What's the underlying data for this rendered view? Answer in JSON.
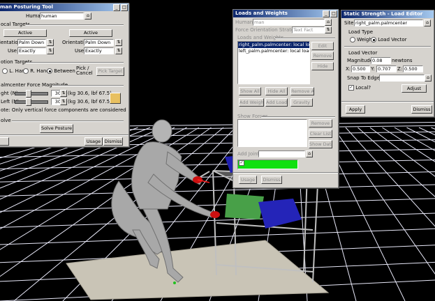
{
  "posture_tool": {
    "title": "man Posturing Tool",
    "human_label": "Human:",
    "human_value": "human",
    "local_targets": "ocal Targets",
    "active_left": "Active",
    "active_right": "Active",
    "orientation_label_left": "ientation:",
    "orientation_left": "Palm Down",
    "orientation_label_right": "Orientation:",
    "orientation_right": "Palm Down",
    "use_label": "Use:",
    "use_left": "Exactly",
    "use_right": "Exactly",
    "motion_targets": "otion Targets",
    "l_hand": "L. Hand",
    "r_hand": "R. Hand",
    "between": "Between",
    "pick_cancel": "Pick / Cancel",
    "pick_target": "Pick Target",
    "force_title": "almcenter Force Magnitude",
    "right_label": "ght (N):",
    "right_value": "30",
    "right_info": "(kg 30.6, lbf 67.5)",
    "left_label": "Left (N):",
    "left_value": "30",
    "left_info": "(kg 30.6, lbf 67.5)",
    "note": "ote: Only vertical force components are considered",
    "solve_label": "olve",
    "solve_button": "Solve Posture",
    "usage": "Usage",
    "dismiss": "Dismiss"
  },
  "loads_weights": {
    "title": "Loads and Weights",
    "human_label": "Human:",
    "human_value": "man",
    "strategy_label": "Force Orientation Strategy:",
    "strategy_value": "Text Fact",
    "loads_label": "Loads and Weights",
    "items": [
      "right_palm.palmcenter: local load",
      "left_palm.palmcenter: local load"
    ],
    "edit": "Edit",
    "remove": "Remove",
    "hide": "Hide",
    "show_all": "Show All",
    "hide_all": "Hide All",
    "remove_all": "Remove All",
    "add_weight": "Add Weight",
    "add_load": "Add Load",
    "gravity": "Gravity",
    "show_forces": "Show Forces",
    "remove2": "Remove",
    "clear_list": "Clear List",
    "show_data": "Show Data",
    "add_joint": "Add Joint",
    "usage": "Usage",
    "dismiss": "Dismiss"
  },
  "load_editor": {
    "title": "Static Strength - Load Editor",
    "site_label": "Site:",
    "site_value": "right_palm.palmcenter",
    "load_type": "Load Type",
    "weight": "Weight",
    "load_vector_radio": "Load Vector",
    "load_vector": "Load Vector",
    "magnitude_label": "Magnitude:",
    "magnitude_value": "0.08",
    "unit": "newtons",
    "x_label": "X:",
    "x_value": "0.500",
    "y_label": "Y:",
    "y_value": "0.707",
    "z_label": "Z:",
    "z_value": "0.500",
    "snap_label": "Snap To Edge:",
    "local_label": "Local?",
    "adjust": "Adjust",
    "apply": "Apply",
    "dismiss": "Dismiss"
  }
}
